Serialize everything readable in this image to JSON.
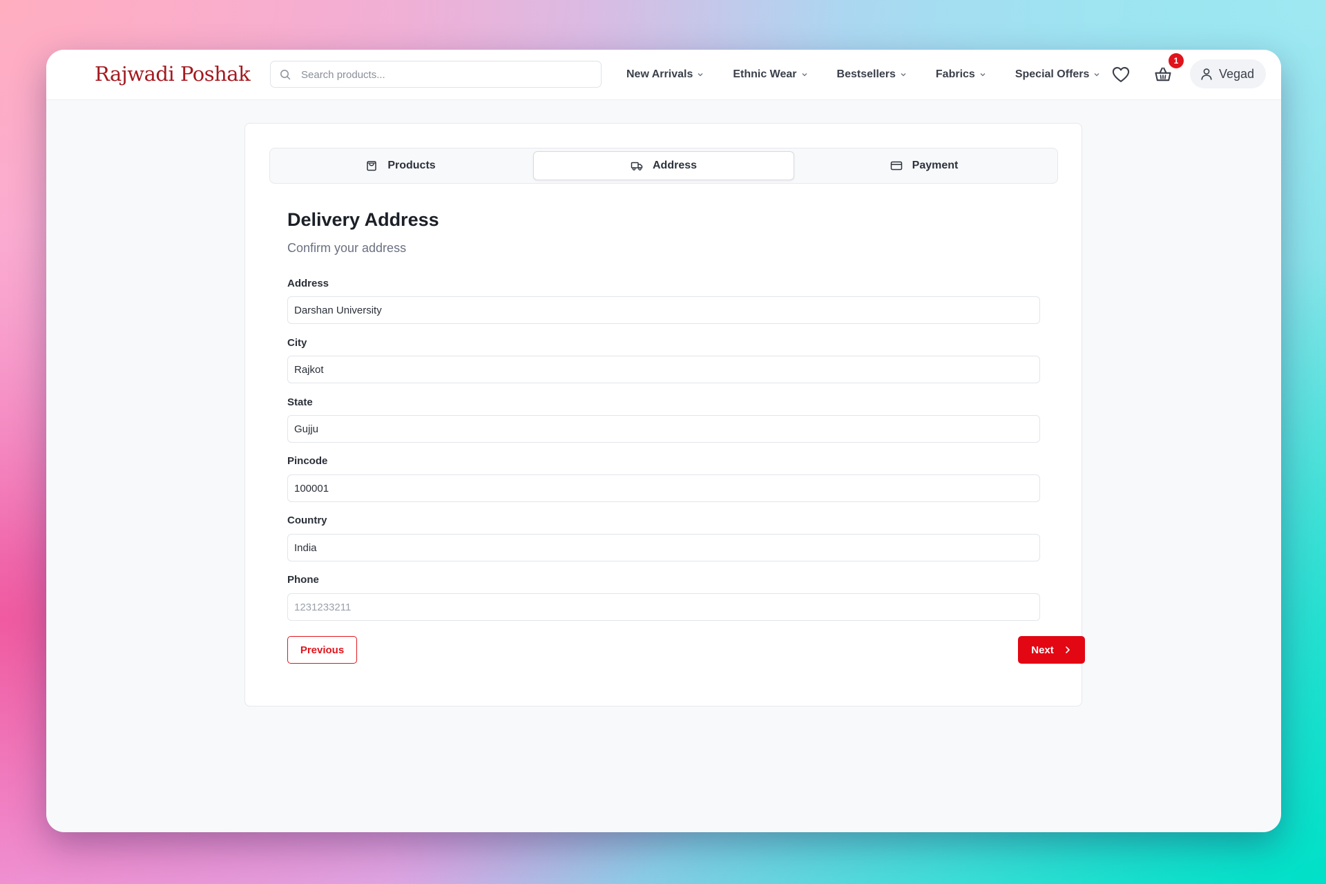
{
  "header": {
    "logo": "Rajwadi Poshak",
    "search_placeholder": "Search products...",
    "nav": [
      {
        "label": "New Arrivals"
      },
      {
        "label": "Ethnic Wear"
      },
      {
        "label": "Bestsellers"
      },
      {
        "label": "Fabrics"
      },
      {
        "label": "Special Offers"
      }
    ],
    "cart_count": "1",
    "user_name": "Vegad",
    "icons": [
      "search-icon",
      "chevron-down-icon",
      "heart-icon",
      "basket-icon",
      "user-icon"
    ]
  },
  "steps": {
    "tabs": [
      {
        "label": "Products",
        "icon": "shopping-bag-icon"
      },
      {
        "label": "Address",
        "icon": "truck-icon",
        "active": true
      },
      {
        "label": "Payment",
        "icon": "credit-card-icon"
      }
    ]
  },
  "form": {
    "title": "Delivery Address",
    "subtitle": "Confirm your address",
    "fields": [
      {
        "label": "Address",
        "value": "Darshan University",
        "placeholder": ""
      },
      {
        "label": "City",
        "value": "Rajkot",
        "placeholder": ""
      },
      {
        "label": "State",
        "value": "Gujju",
        "placeholder": ""
      },
      {
        "label": "Pincode",
        "value": "100001",
        "placeholder": ""
      },
      {
        "label": "Country",
        "value": "India",
        "placeholder": ""
      },
      {
        "label": "Phone",
        "value": "",
        "placeholder": "1231233211"
      }
    ],
    "previous_label": "Previous",
    "next_label": "Next"
  },
  "colors": {
    "brand": "#a3191f",
    "accent": "#e30613"
  }
}
